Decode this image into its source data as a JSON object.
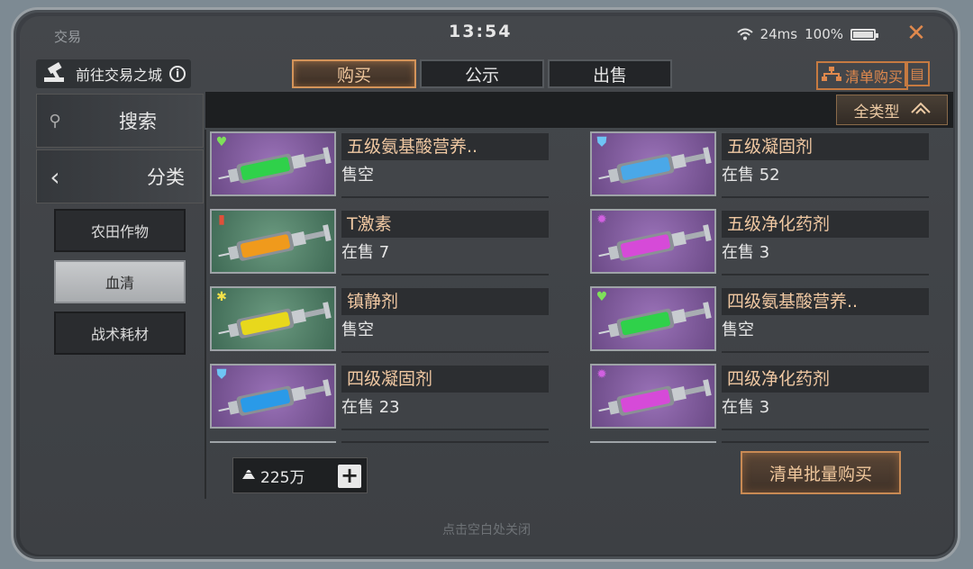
{
  "window": {
    "title": "交易",
    "time": "13:54",
    "latency": "24ms",
    "battery": "100%"
  },
  "goto_city": {
    "label": "前往交易之城",
    "info": "i"
  },
  "tabs": [
    {
      "label": "购买"
    },
    {
      "label": "公示"
    },
    {
      "label": "出售"
    }
  ],
  "top_actions": {
    "list_buy": "清单购买"
  },
  "filter": {
    "type_label": "全类型"
  },
  "sidebar": {
    "search_label": "搜索",
    "category_label": "分类",
    "subcategories": [
      {
        "label": "农田作物"
      },
      {
        "label": "血清"
      },
      {
        "label": "战术耗材"
      }
    ]
  },
  "items": [
    {
      "name": "五级氨基酸营养..",
      "stock": "售空",
      "badge": "heart-plus-icon",
      "color": "#2fd14a"
    },
    {
      "name": "五级凝固剂",
      "stock": "在售 52",
      "badge": "shield-icon",
      "color": "#4aa8e8"
    },
    {
      "name": "T激素",
      "stock": "在售 7",
      "badge": "bullet-icon",
      "color": "#f09a1c"
    },
    {
      "name": "五级净化药剂",
      "stock": "在售 3",
      "badge": "gear-icon",
      "color": "#d64ad8"
    },
    {
      "name": "镇静剂",
      "stock": "售空",
      "badge": "snowflake-icon",
      "color": "#e8d81c"
    },
    {
      "name": "四级氨基酸营养..",
      "stock": "售空",
      "badge": "heart-plus-icon",
      "color": "#2fd14a"
    },
    {
      "name": "四级凝固剂",
      "stock": "在售 23",
      "badge": "shield-icon",
      "color": "#2a9ae8"
    },
    {
      "name": "四级净化药剂",
      "stock": "在售 3",
      "badge": "gear-icon",
      "color": "#d64ad8"
    }
  ],
  "wallet": {
    "amount": "225万"
  },
  "batch_buy": {
    "label": "清单批量购买"
  },
  "hint": {
    "text": "点击空白处关闭"
  }
}
